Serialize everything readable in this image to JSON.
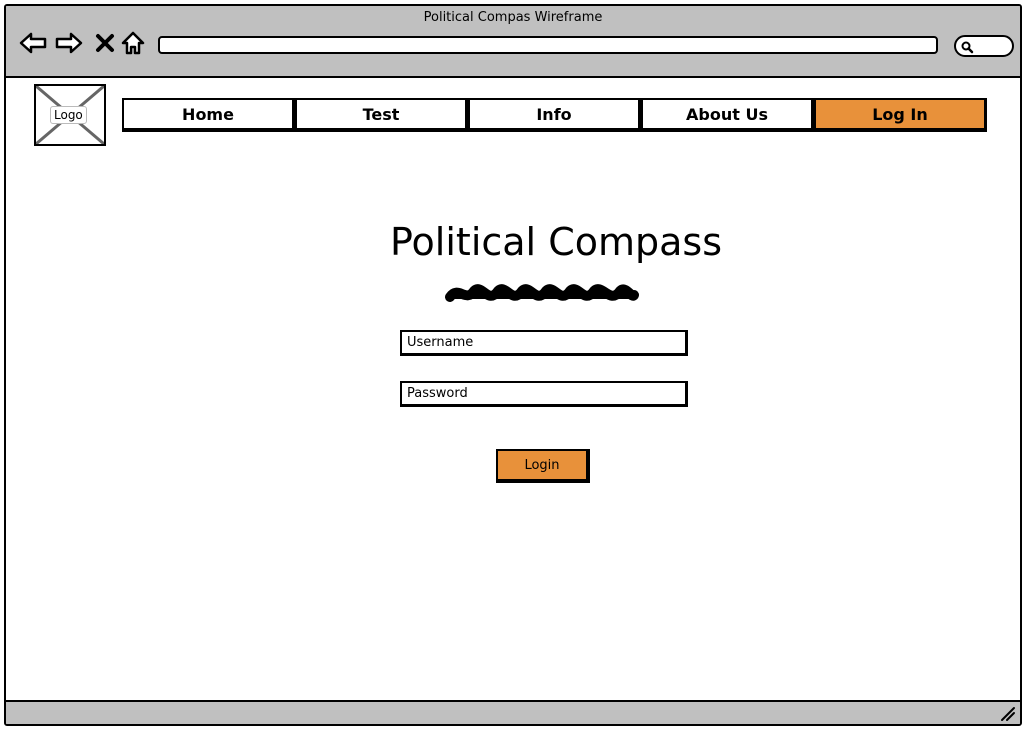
{
  "window": {
    "title": "Political Compas Wireframe"
  },
  "browser": {
    "icons": [
      "back-arrow-icon",
      "forward-arrow-icon",
      "close-x-icon",
      "home-icon",
      "search-icon"
    ]
  },
  "header": {
    "logo_label": "Logo",
    "tabs": [
      {
        "label": "Home",
        "active": false
      },
      {
        "label": "Test",
        "active": false
      },
      {
        "label": "Info",
        "active": false
      },
      {
        "label": "About Us",
        "active": false
      },
      {
        "label": "Log In",
        "active": true
      }
    ]
  },
  "main": {
    "title": "Political Compass",
    "username_placeholder": "Username",
    "password_placeholder": "Password",
    "login_label": "Login"
  },
  "colors": {
    "accent": "#e8913a",
    "chrome": "#c0c0c0",
    "border": "#000000",
    "background": "#ffffff"
  }
}
